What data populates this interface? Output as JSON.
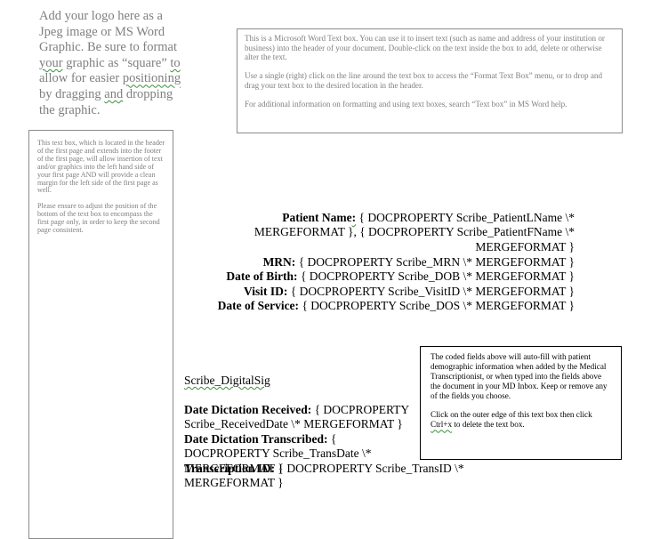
{
  "logo_placeholder": {
    "part1": "Add your logo here as a Jpeg image or MS Word Graphic. Be sure to format ",
    "squiggle1": "your",
    "part2": " graphic as “square” ",
    "squiggle2": "to",
    "part3": " allow for easier ",
    "squiggle3": "positioning",
    "part4": " by dragging ",
    "squiggle4": "and",
    "part5": " dropping the graphic."
  },
  "header_textbox": {
    "para1": "This is a Microsoft Word Text box. You can use it to insert text (such as name and address of your institution or business) into the header of your document. Double-click on the text inside the box to add, delete or otherwise alter the text.",
    "para2": "Use a single (right) click on the line around the text box to access the “Format Text Box” menu, or to drop and drag your text box to the desired location in the header.",
    "para3": "For additional information on formatting and using text boxes, search “Text box” in MS Word help."
  },
  "left_textbox": {
    "para1": "This text box, which is located in the header of the first page and extends into the footer of the first page, will allow insertion of text and/or graphics into the left hand side of your first page AND will provide a clean margin for the left side of the first page as well.",
    "para2": "Please ensure to adjust the position of the bottom of the text box to encompass the first page only, in order to keep the second page consistent."
  },
  "patient": {
    "name_label": "Patient Name",
    "name_colon": ":",
    "name_fields": " { DOCPROPERTY   Scribe_PatientLName   \\* MERGEFORMAT }, { DOCPROPERTY   Scribe_PatientFName   \\* MERGEFORMAT }",
    "mrn_label": "MRN:",
    "mrn_field": " { DOCPROPERTY   Scribe_MRN   \\* MERGEFORMAT }",
    "dob_label": "Date of Birth:",
    "dob_field": " { DOCPROPERTY   Scribe_DOB   \\* MERGEFORMAT }",
    "visit_label": "Visit ID:",
    "visit_field": " { DOCPROPERTY   Scribe_VisitID   \\* MERGEFORMAT }",
    "dos_label": "Date of Service:",
    "dos_field": "  { DOCPROPERTY   Scribe_DOS   \\* MERGEFORMAT }"
  },
  "dictation": {
    "digital_sig": "Scribe_DigitalSig",
    "received_label": "Date Dictation Received:",
    "received_field": "  { DOCPROPERTY   Scribe_ReceivedDate   \\* MERGEFORMAT }",
    "transcribed_label": "Date Dictation Transcribed:",
    "transcribed_field": "  { DOCPROPERTY   Scribe_TransDate   \\* MERGEFORMAT }",
    "transid_label": "Transcription ID:",
    "transid_field": "  { DOCPROPERTY   Scribe_TransID   \\* MERGEFORMAT }"
  },
  "note_textbox": {
    "para1": "The coded fields above will auto-fill with patient demographic information when added by the Medical Transcriptionist, or when typed into the fields above the document in your MD Inbox. Keep or remove any of the fields you choose.",
    "para2_part1": "Click on the outer edge of this text box then click ",
    "para2_squiggle": "Ctrl+x",
    "para2_part2": " to delete the text box."
  }
}
